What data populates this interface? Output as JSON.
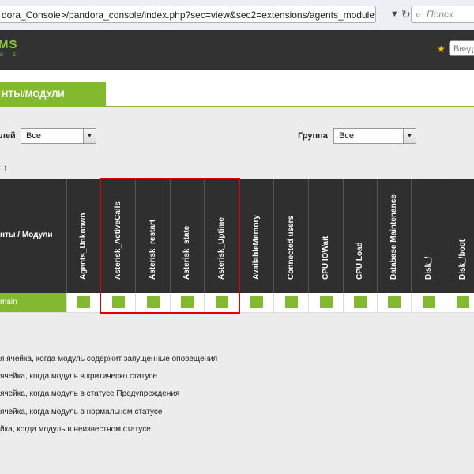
{
  "browser": {
    "url": "dora_Console>/pandora_console/index.php?sec=view&sec2=extensions/agents_modules",
    "search_placeholder": "Поиск",
    "search_icon": "search-icon"
  },
  "header": {
    "logo_text": "MS",
    "logo_sub": "C E",
    "star_icon": "star-icon",
    "search_placeholder": "Введ"
  },
  "tab": {
    "label": "НТЫ/МОДУЛИ"
  },
  "filters": {
    "module_group_label": "лей",
    "module_group_value": "Все",
    "group_label": "Группа",
    "group_value": "Все"
  },
  "pager": "1",
  "table": {
    "corner_label": "нты / Модули",
    "columns": [
      "Agents_Unknown",
      "Asterisk_ActiveCalls",
      "Asterisk_restart",
      "Asterisk_state",
      "Asterisk_Uptime",
      "AvailableMemory",
      "Connected users",
      "CPU IOWait",
      "CPU Load",
      "Database Maintenance",
      "Disk_/",
      "Disk_/boot"
    ],
    "rows": [
      {
        "agent": "main",
        "statuses": [
          "normal",
          "normal",
          "normal",
          "normal",
          "normal",
          "normal",
          "normal",
          "normal",
          "normal",
          "normal",
          "normal",
          "normal"
        ]
      }
    ]
  },
  "legend": [
    "я ячейка, когда модуль содержит запущенные оповещения",
    "ячейка, когда модуль в критическо статусе",
    "ячейка, когда модуль в статусе Предупреждения",
    "ячейка, когда модуль в нормальном статусе",
    "йка, когда модуль в неизвестном статусе"
  ],
  "colors": {
    "accent": "#82b92e",
    "header_bg": "#323232",
    "table_header_bg": "#2f2f2f",
    "highlight": "#e00000"
  }
}
